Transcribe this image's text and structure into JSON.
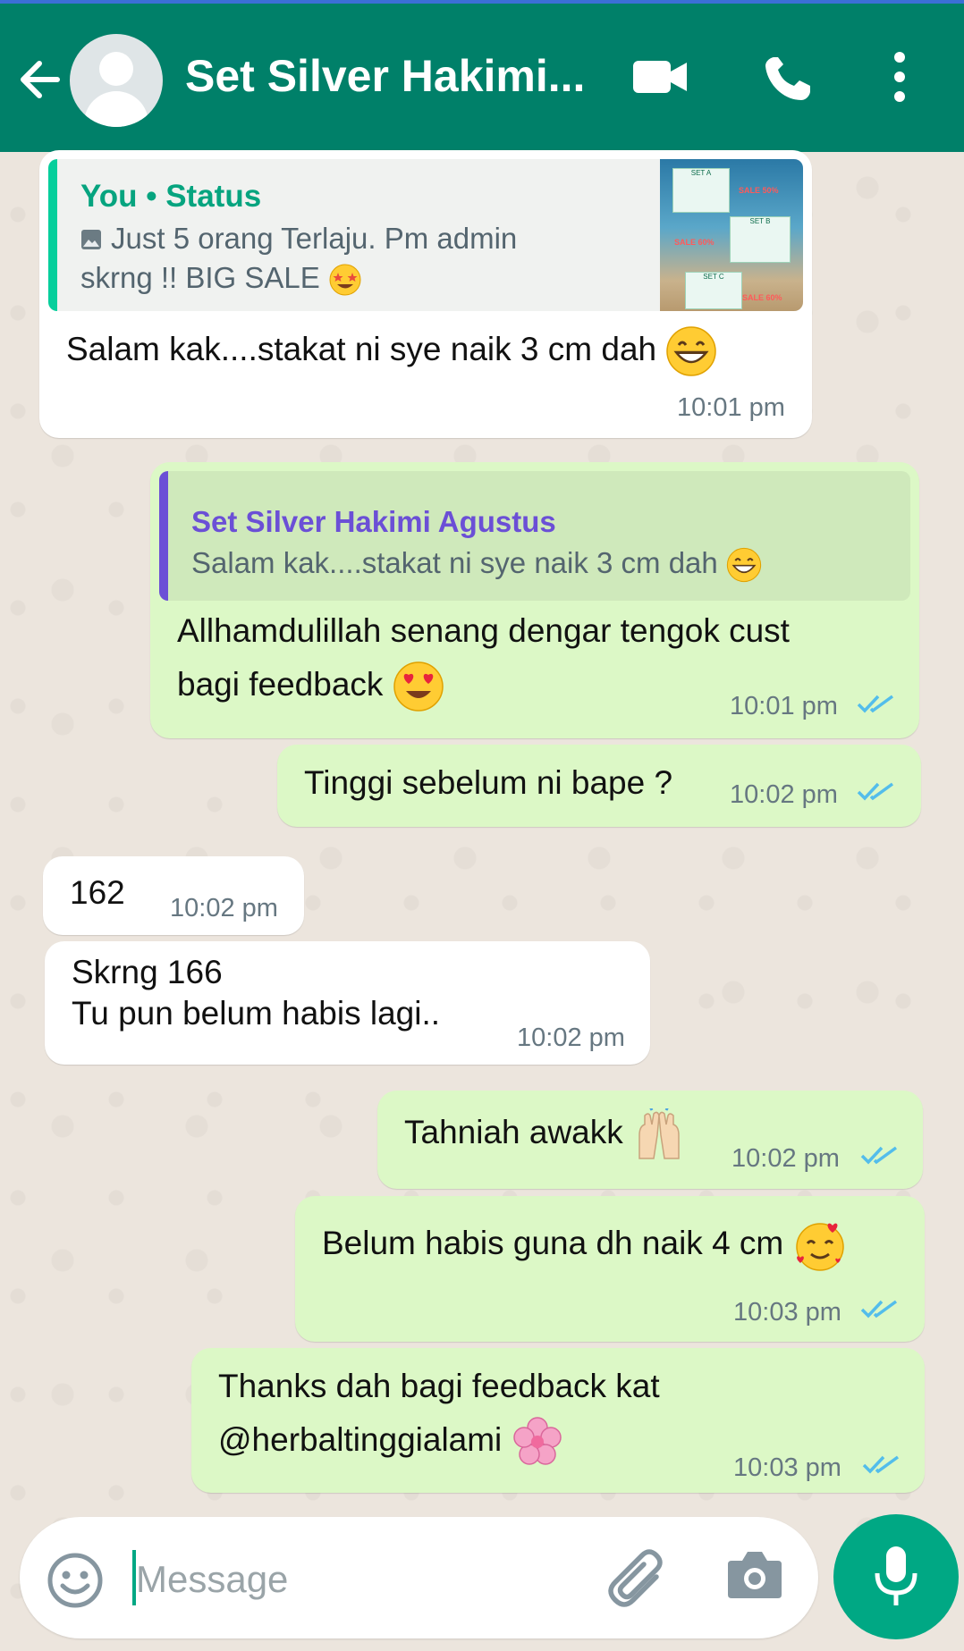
{
  "header": {
    "contact_name": "Set Silver Hakimi...",
    "colors": {
      "bar": "#008069",
      "accent": "#00a884"
    }
  },
  "messages": [
    {
      "direction": "incoming",
      "quote": {
        "author": "You • Status",
        "line1": "Just 5 orang Terlaju. Pm admin",
        "line2": "skrng !! BIG SALE",
        "thumb_labels": [
          "SET A",
          "SALE 50%",
          "SET B",
          "SALE 60%",
          "SET C",
          "SALE 60%"
        ]
      },
      "text": "Salam kak....stakat ni sye naik 3 cm dah",
      "emoji": "grinning-face",
      "time": "10:01 pm"
    },
    {
      "direction": "outgoing",
      "quote": {
        "author": "Set Silver Hakimi Agustus",
        "text": "Salam kak....stakat ni sye naik 3 cm dah"
      },
      "line1": "Allhamdulillah senang dengar tengok cust",
      "line2": "bagi feedback",
      "emoji": "heart-eyes",
      "time": "10:01 pm",
      "status": "read"
    },
    {
      "direction": "outgoing",
      "text": "Tinggi sebelum ni bape ?",
      "time": "10:02 pm",
      "status": "read"
    },
    {
      "direction": "incoming",
      "text": "162",
      "time": "10:02 pm"
    },
    {
      "direction": "incoming",
      "line1": "Skrng 166",
      "line2": "Tu pun belum habis lagi..",
      "time": "10:02 pm"
    },
    {
      "direction": "outgoing",
      "text": "Tahniah awakk",
      "emoji": "raising-hands",
      "time": "10:02 pm",
      "status": "read"
    },
    {
      "direction": "outgoing",
      "text": "Belum habis guna dh naik 4 cm",
      "emoji": "smiling-hearts",
      "time": "10:03 pm",
      "status": "read"
    },
    {
      "direction": "outgoing",
      "line1": "Thanks dah bagi feedback kat",
      "line2": "@herbaltinggialami",
      "emoji": "cherry-blossom",
      "time": "10:03 pm",
      "status": "read"
    }
  ],
  "composer": {
    "placeholder": "Message",
    "icons": [
      "emoji-icon",
      "attach-icon",
      "camera-icon",
      "mic-icon"
    ]
  }
}
